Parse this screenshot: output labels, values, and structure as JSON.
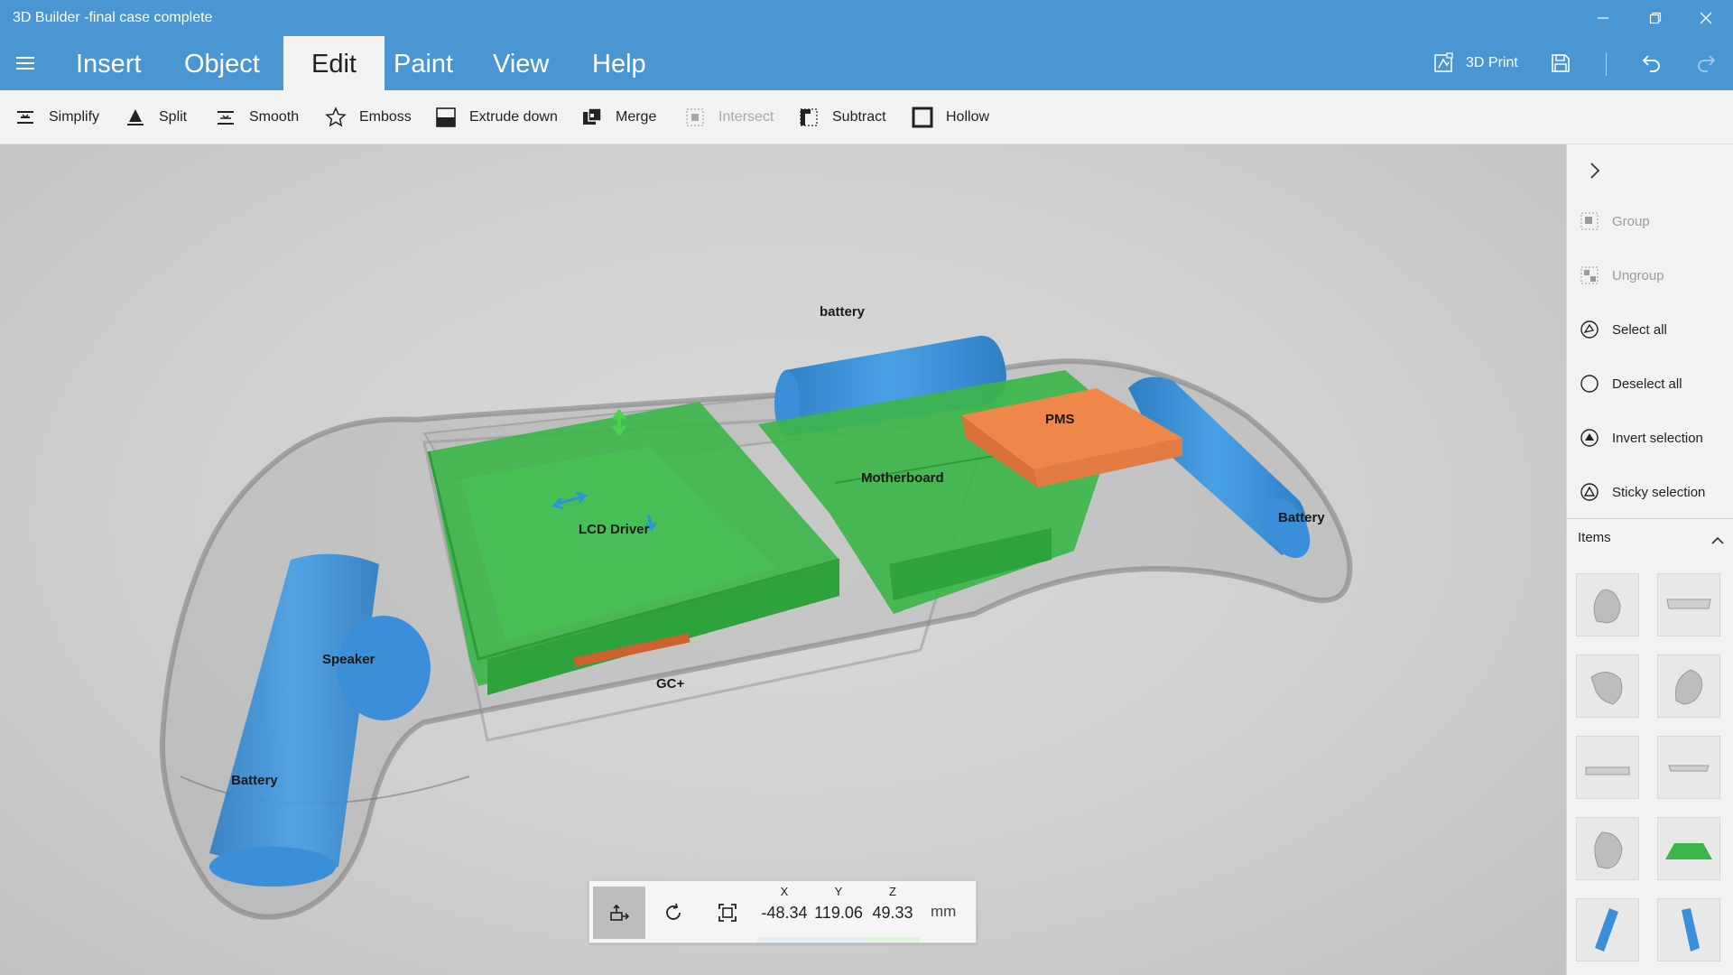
{
  "window": {
    "title": "3D Builder -final case complete",
    "minimize_icon": "minimize-icon",
    "maximize_icon": "restore-icon",
    "close_icon": "close-icon"
  },
  "menu": {
    "tabs": [
      {
        "label": "Insert",
        "active": false
      },
      {
        "label": "Object",
        "active": false
      },
      {
        "label": "Edit",
        "active": true
      },
      {
        "label": "Paint",
        "active": false
      },
      {
        "label": "View",
        "active": false
      },
      {
        "label": "Help",
        "active": false
      }
    ],
    "print_label": "3D Print",
    "accent": "#4a96d2"
  },
  "ribbon": {
    "buttons": [
      {
        "label": "Simplify",
        "icon": "simplify-icon",
        "enabled": true
      },
      {
        "label": "Split",
        "icon": "split-icon",
        "enabled": true
      },
      {
        "label": "Smooth",
        "icon": "smooth-icon",
        "enabled": true
      },
      {
        "label": "Emboss",
        "icon": "star-icon",
        "enabled": true
      },
      {
        "label": "Extrude down",
        "icon": "extrude-icon",
        "enabled": true
      },
      {
        "label": "Merge",
        "icon": "merge-icon",
        "enabled": true
      },
      {
        "label": "Intersect",
        "icon": "intersect-icon",
        "enabled": false
      },
      {
        "label": "Subtract",
        "icon": "subtract-icon",
        "enabled": true
      },
      {
        "label": "Hollow",
        "icon": "hollow-icon",
        "enabled": true
      }
    ]
  },
  "scene": {
    "labels": {
      "battery_top": "battery",
      "pms": "PMS",
      "motherboard": "Motherboard",
      "lcd_driver": "LCD Driver",
      "battery_right": "Battery",
      "speaker": "Speaker",
      "gc": "GC+",
      "battery_left": "Battery"
    },
    "colors": {
      "board": "#3cb54a",
      "battery": "#3c8fd6",
      "pms": "#f0874a",
      "case": "#9a9a9a"
    }
  },
  "coords": {
    "x_label": "X",
    "x_value": "-48.34",
    "y_label": "Y",
    "y_value": "119.06",
    "z_label": "Z",
    "z_value": "49.33",
    "unit": "mm"
  },
  "side_panel": {
    "actions": [
      {
        "label": "Group",
        "icon": "group-icon",
        "enabled": false
      },
      {
        "label": "Ungroup",
        "icon": "ungroup-icon",
        "enabled": false
      },
      {
        "label": "Select all",
        "icon": "select-all-icon",
        "enabled": true
      },
      {
        "label": "Deselect all",
        "icon": "deselect-all-icon",
        "enabled": true
      },
      {
        "label": "Invert selection",
        "icon": "invert-selection-icon",
        "enabled": true
      },
      {
        "label": "Sticky selection",
        "icon": "sticky-selection-icon",
        "enabled": true
      }
    ],
    "items_title": "Items"
  }
}
